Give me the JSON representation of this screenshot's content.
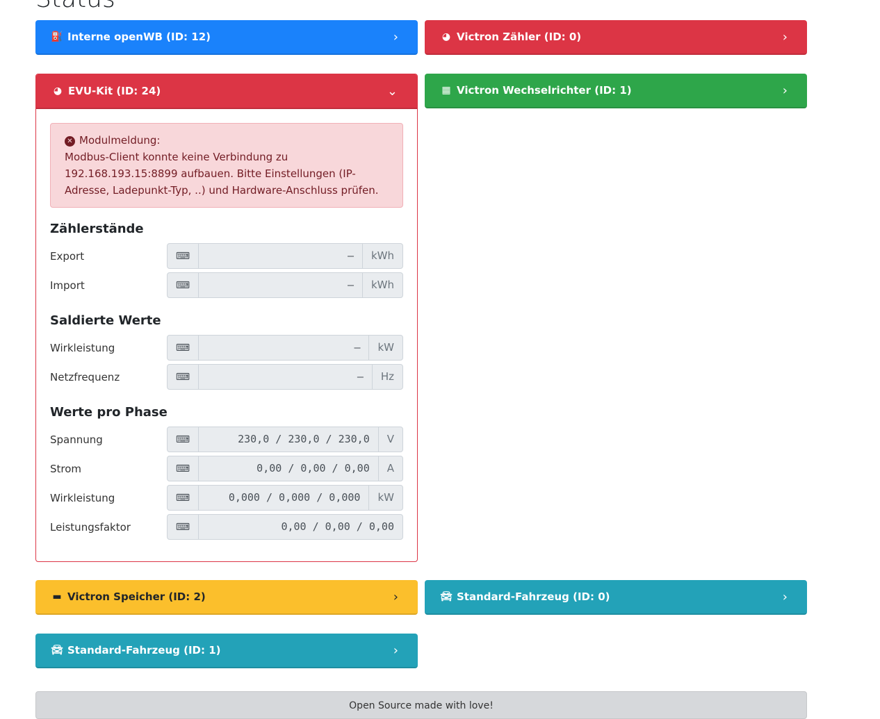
{
  "page_title": "Status",
  "cards": [
    {
      "label": "Interne openWB (ID: 12)",
      "icon": "charging-station-icon",
      "color": "#1a82fb"
    },
    {
      "label": "Victron Zähler (ID: 0)",
      "icon": "tachometer-icon",
      "color": "#dc3545"
    },
    {
      "label": "EVU-Kit (ID: 24)",
      "icon": "tachometer-icon",
      "color": "#dc3545",
      "expanded": true
    },
    {
      "label": "Victron Wechselrichter (ID: 1)",
      "icon": "solar-panel-icon",
      "color": "#2ea64a"
    },
    {
      "label": "Victron Speicher (ID: 2)",
      "icon": "car-battery-icon",
      "color": "#fbbf2c"
    },
    {
      "label": "Standard-Fahrzeug (ID: 0)",
      "icon": "car-icon",
      "color": "#23a2b8"
    },
    {
      "label": "Standard-Fahrzeug (ID: 1)",
      "icon": "car-icon",
      "color": "#23a2b8"
    }
  ],
  "evu": {
    "alert_title": "Modulmeldung:",
    "alert_text": "Modbus-Client konnte keine Verbindung zu 192.168.193.15:8899 aufbauen. Bitte Einstellungen (IP-Adresse, Ladepunkt-Typ, ..) und Hardware-Anschluss prüfen.",
    "sections": [
      {
        "title": "Zählerstände",
        "rows": [
          {
            "label": "Export",
            "value": "–",
            "unit": "kWh"
          },
          {
            "label": "Import",
            "value": "–",
            "unit": "kWh"
          }
        ]
      },
      {
        "title": "Saldierte Werte",
        "rows": [
          {
            "label": "Wirkleistung",
            "value": "–",
            "unit": "kW"
          },
          {
            "label": "Netzfrequenz",
            "value": "–",
            "unit": "Hz"
          }
        ]
      },
      {
        "title": "Werte pro Phase",
        "rows": [
          {
            "label": "Spannung",
            "value": "230,0 / 230,0 / 230,0",
            "unit": "V"
          },
          {
            "label": "Strom",
            "value": "0,00 / 0,00 / 0,00",
            "unit": "A"
          },
          {
            "label": "Wirkleistung",
            "value": "0,000 / 0,000 / 0,000",
            "unit": "kW"
          },
          {
            "label": "Leistungsfaktor",
            "value": "0,00 / 0,00 / 0,00",
            "unit": ""
          }
        ]
      }
    ]
  },
  "footer": "Open Source made with love!"
}
